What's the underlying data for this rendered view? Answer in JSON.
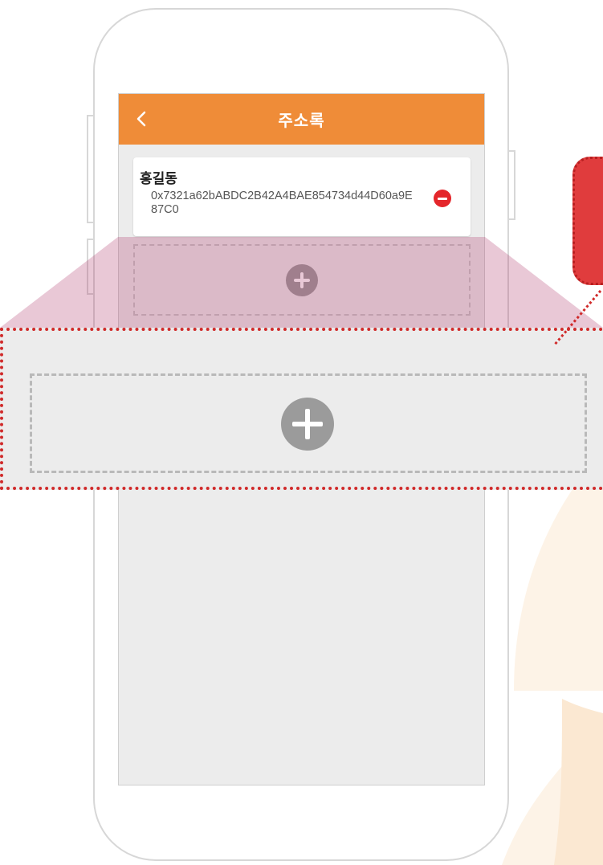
{
  "header": {
    "title": "주소록"
  },
  "entries": [
    {
      "name": "홍길동",
      "address": "0x7321a62bABDC2B42A4BAE854734d44D60a9E87C0"
    }
  ],
  "icons": {
    "back": "chevron-left-icon",
    "remove": "minus-circle-icon",
    "add": "plus-circle-icon"
  },
  "colors": {
    "appbar": "#ef8c38",
    "remove": "#e4262b",
    "highlight": "#d02a2a",
    "zoom_tint": "#b03a6a"
  }
}
